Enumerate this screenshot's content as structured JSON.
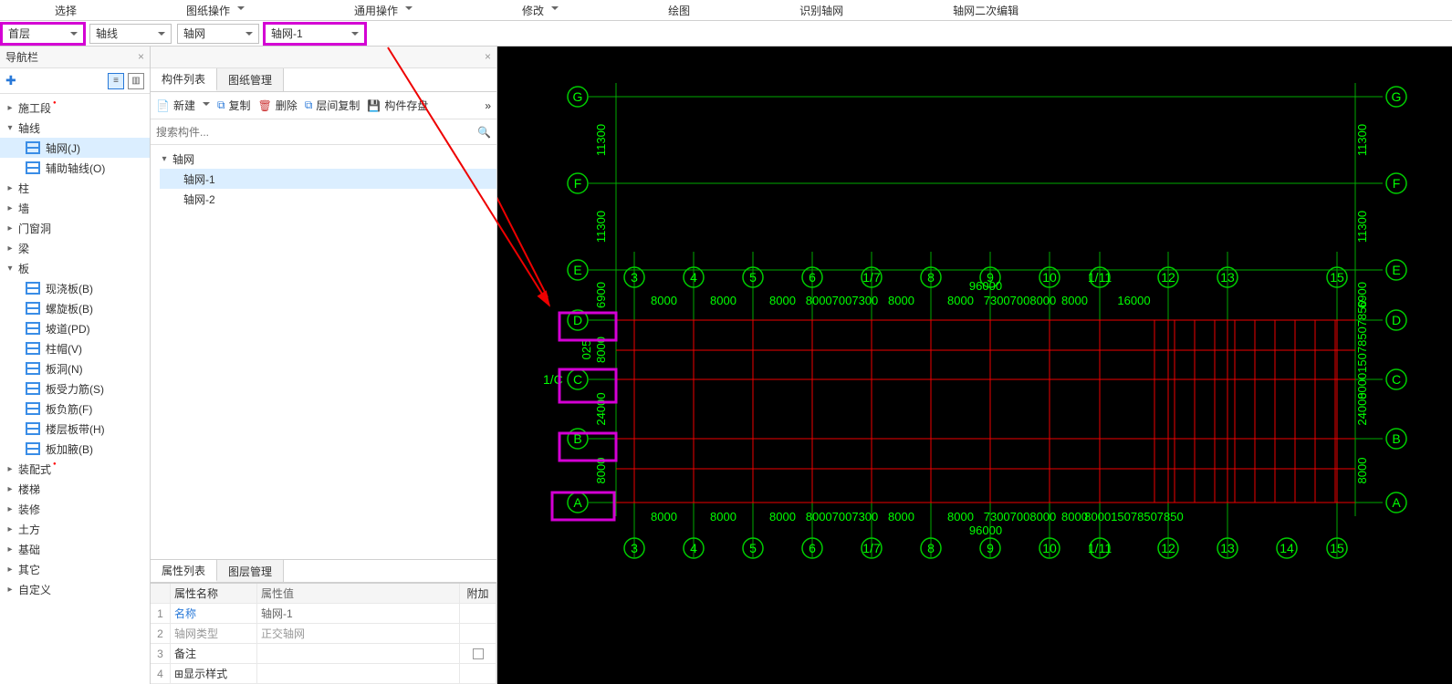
{
  "menu": {
    "select": "选择",
    "drawing_ops": "图纸操作",
    "general_ops": "通用操作",
    "modify": "修改",
    "draw": "绘图",
    "recog_grid": "识别轴网",
    "grid_edit": "轴网二次编辑"
  },
  "dropdowns": {
    "floor": "首层",
    "axis": "轴线",
    "grid": "轴网",
    "grid_item": "轴网-1"
  },
  "nav": {
    "title": "导航栏",
    "items": [
      {
        "label": "施工段",
        "expander": "▸",
        "red": true
      },
      {
        "label": "轴线",
        "expander": "▾",
        "children": [
          {
            "label": "轴网(J)",
            "selected": true,
            "icon": "grid"
          },
          {
            "label": "辅助轴线(O)",
            "icon": "grid"
          }
        ]
      },
      {
        "label": "柱",
        "expander": "▸"
      },
      {
        "label": "墙",
        "expander": "▸"
      },
      {
        "label": "门窗洞",
        "expander": "▸"
      },
      {
        "label": "梁",
        "expander": "▸"
      },
      {
        "label": "板",
        "expander": "▾",
        "children": [
          {
            "label": "现浇板(B)",
            "icon": "slab"
          },
          {
            "label": "螺旋板(B)",
            "icon": "slab"
          },
          {
            "label": "坡道(PD)",
            "icon": "slab"
          },
          {
            "label": "柱帽(V)",
            "icon": "slab"
          },
          {
            "label": "板洞(N)",
            "icon": "slab"
          },
          {
            "label": "板受力筋(S)",
            "icon": "slab"
          },
          {
            "label": "板负筋(F)",
            "icon": "slab"
          },
          {
            "label": "楼层板带(H)",
            "icon": "slab"
          },
          {
            "label": "板加腋(B)",
            "icon": "slab"
          }
        ]
      },
      {
        "label": "装配式",
        "expander": "▸",
        "red": true
      },
      {
        "label": "楼梯",
        "expander": "▸"
      },
      {
        "label": "装修",
        "expander": "▸"
      },
      {
        "label": "土方",
        "expander": "▸"
      },
      {
        "label": "基础",
        "expander": "▸"
      },
      {
        "label": "其它",
        "expander": "▸"
      },
      {
        "label": "自定义",
        "expander": "▸"
      }
    ]
  },
  "comp_panel": {
    "tabs": {
      "list": "构件列表",
      "manage": "图纸管理"
    },
    "toolbar": {
      "new": "新建",
      "copy": "复制",
      "delete": "删除",
      "layer_copy": "层间复制",
      "save": "构件存盘"
    },
    "search_placeholder": "搜索构件...",
    "tree": {
      "root": "轴网",
      "children": [
        "轴网-1",
        "轴网-2"
      ],
      "selected": "轴网-1"
    }
  },
  "prop_panel": {
    "tabs": {
      "props": "属性列表",
      "layers": "图层管理"
    },
    "head": {
      "name": "属性名称",
      "value": "属性值",
      "extra": "附加"
    },
    "rows": [
      {
        "idx": "1",
        "name": "名称",
        "value": "轴网-1",
        "link": true
      },
      {
        "idx": "2",
        "name": "轴网类型",
        "value": "正交轴网",
        "link": true,
        "gray": true
      },
      {
        "idx": "3",
        "name": "备注",
        "value": "",
        "chk": true
      },
      {
        "idx": "4",
        "name": "显示样式",
        "value": "",
        "expand": true
      }
    ]
  },
  "canvas": {
    "v_axes_left": [
      "G",
      "F",
      "E",
      "D",
      "B",
      "A"
    ],
    "c_label_left": "1/C",
    "c_inner": "C",
    "v_axes_right": [
      "G",
      "F",
      "E",
      "D",
      "C",
      "B",
      "A"
    ],
    "h_axes": [
      "3",
      "4",
      "5",
      "6",
      "1/7",
      "8",
      "9",
      "10",
      "1/11",
      "12",
      "13",
      "15"
    ],
    "h_axes_bottom": [
      "3",
      "4",
      "5",
      "6",
      "1/7",
      "8",
      "9",
      "10",
      "1/11",
      "12",
      "13",
      "14",
      "15"
    ],
    "v_dims_left": [
      "11300",
      "11300",
      "6900",
      "8000",
      "24000",
      "8000"
    ],
    "v_dims_right": [
      "11300",
      "11300",
      "6900",
      "800015078507850",
      "24000",
      "8000"
    ],
    "h_dims_top": [
      "8000",
      "8000",
      "8000",
      "80007007300",
      "8000",
      "8000",
      "73007008000",
      "8000",
      "16000"
    ],
    "h_dims_bottom": [
      "8000",
      "8000",
      "8000",
      "80007007300",
      "8000",
      "8000",
      "73007008000",
      "8000",
      "800015078507850"
    ],
    "total_h": "96000",
    "extra_c": "025"
  }
}
